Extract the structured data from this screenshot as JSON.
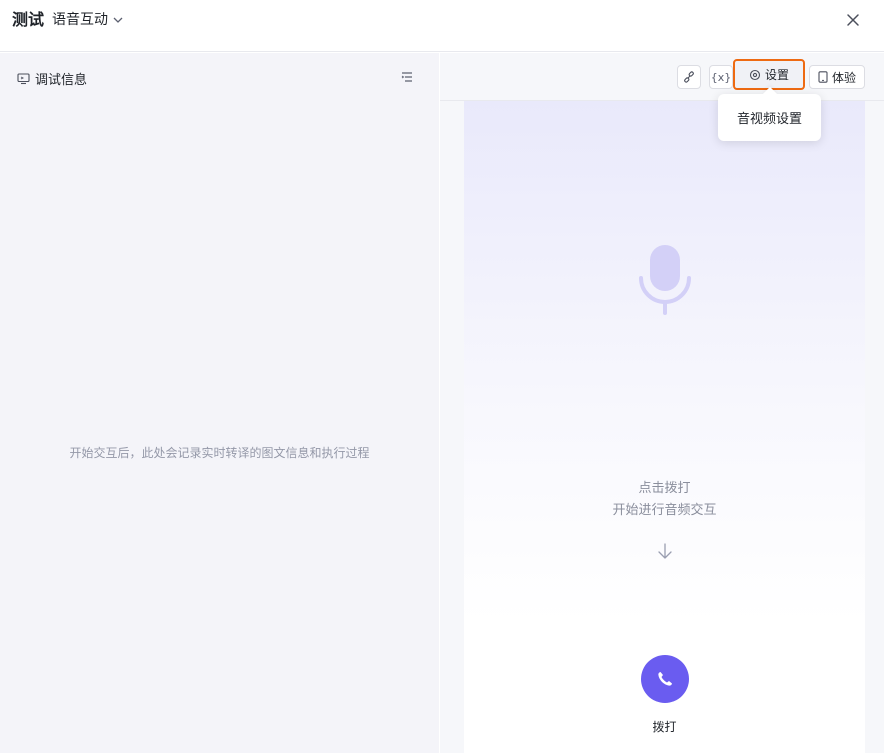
{
  "header": {
    "title": "测试",
    "mode": "语音互动"
  },
  "left_panel": {
    "title": "调试信息",
    "empty_text": "开始交互后，此处会记录实时转译的图文信息和执行过程"
  },
  "toolbar": {
    "variable_label": "{x}",
    "settings_label": "设置",
    "experience_label": "体验"
  },
  "tooltip": {
    "text": "音视频设置"
  },
  "phone": {
    "tip_line1": "点击拨打",
    "tip_line2": "开始进行音频交互",
    "call_label": "拨打"
  },
  "colors": {
    "accent": "#6a5cf0",
    "highlight": "#ee6a12"
  }
}
